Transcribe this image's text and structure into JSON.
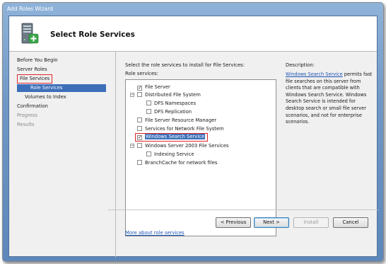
{
  "window": {
    "title": "Add Roles Wizard"
  },
  "header": {
    "title": "Select Role Services",
    "icon": "server-install-icon"
  },
  "steps": [
    {
      "label": "Before You Begin",
      "state": "normal"
    },
    {
      "label": "Server Roles",
      "state": "normal"
    },
    {
      "label": "File Services",
      "state": "highlighted-box"
    },
    {
      "label": "Role Services",
      "state": "selected"
    },
    {
      "label": "Volumes to Index",
      "state": "normal"
    },
    {
      "label": "Confirmation",
      "state": "normal"
    },
    {
      "label": "Progress",
      "state": "disabled"
    },
    {
      "label": "Results",
      "state": "disabled"
    }
  ],
  "content": {
    "instruction": "Select the role services to install for File Services:",
    "role_services_label": "Role services:",
    "tree": [
      {
        "label": "File Server",
        "checked": true,
        "level": 0
      },
      {
        "label": "Distributed File System",
        "checked": false,
        "level": 0,
        "expanded": true
      },
      {
        "label": "DFS Namespaces",
        "checked": false,
        "level": 1
      },
      {
        "label": "DFS Replication",
        "checked": false,
        "level": 1
      },
      {
        "label": "File Server Resource Manager",
        "checked": false,
        "level": 0
      },
      {
        "label": "Services for Network File System",
        "checked": false,
        "level": 0
      },
      {
        "label": "Windows Search Service",
        "checked": true,
        "level": 0,
        "selected": true
      },
      {
        "label": "Windows Server 2003 File Services",
        "checked": false,
        "level": 0,
        "expanded": true
      },
      {
        "label": "Indexing Service",
        "checked": false,
        "level": 1
      },
      {
        "label": "BranchCache for network files",
        "checked": false,
        "level": 0
      }
    ],
    "description_label": "Description:",
    "description_link": "Windows Search Service",
    "description_text": " permits fast file searches on this server from clients that are compatible with Windows Search Service. Windows Search Service is intended for desktop search or small file server scenarios, and not for enterprise scenarios.",
    "more_link": "More about role services"
  },
  "buttons": {
    "previous": "< Previous",
    "next": "Next >",
    "install": "Install",
    "cancel": "Cancel"
  },
  "colors": {
    "selection": "#3d6fb9",
    "highlight_box": "#e0242b",
    "link": "#1d53b3"
  }
}
